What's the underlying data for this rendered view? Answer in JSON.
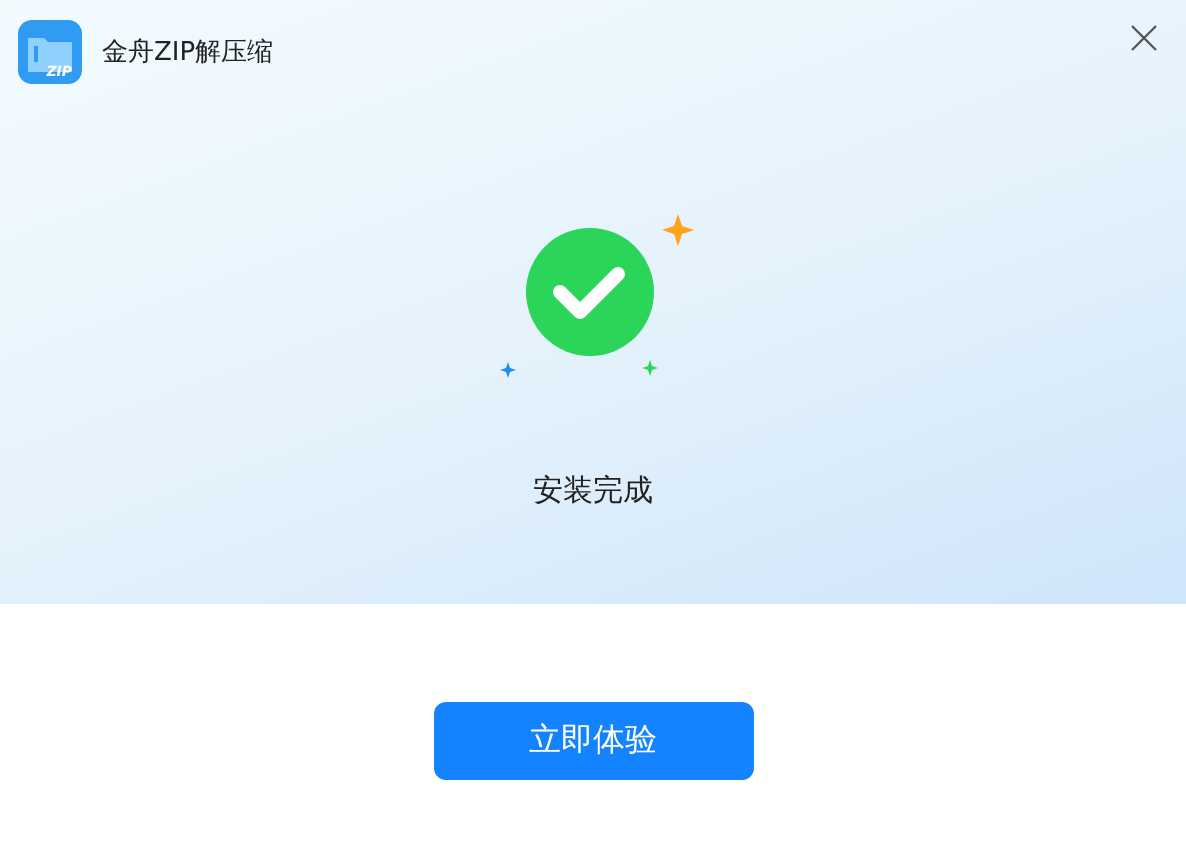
{
  "window": {
    "title": "金舟ZIP解压缩",
    "logo_text": "ZIP"
  },
  "status": {
    "message": "安装完成"
  },
  "buttons": [
    "立即体验"
  ]
}
